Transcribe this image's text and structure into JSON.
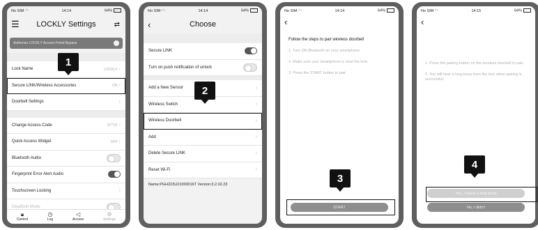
{
  "status": {
    "carrier": "No SIM",
    "wifi_icon": "wifi-icon",
    "battery_icon": "battery-icon",
    "p1_time": "14:14",
    "p1_battery": "64%",
    "p2_time": "14:14",
    "p2_battery": "64%",
    "p3_time": "14:14",
    "p3_battery": "64%",
    "p4_time": "14:15",
    "p4_battery": "64%"
  },
  "screen1": {
    "title": "LOCKLY Settings",
    "menu_icon": "menu-icon",
    "sync_icon": "sync-icon",
    "banner_label": "Authorize LOCKLY Access Portal Bypass",
    "rows": [
      {
        "label": "Lock Name",
        "value": "LOCKLY"
      },
      {
        "label": "Secure LINK/Wireless Accessories",
        "value": "ON"
      },
      {
        "label": "Doorbell Settings",
        "value": ""
      },
      {
        "label": "Change Access Code",
        "value": "22**22"
      },
      {
        "label": "Quick Access Widget",
        "value": "OFF"
      },
      {
        "label": "Bluetooth Audio",
        "value": ""
      },
      {
        "label": "Fingerprint Error Alert Audio",
        "value": ""
      },
      {
        "label": "Touchscreen Locking",
        "value": ""
      },
      {
        "label": "Deadbolt Mode",
        "value": ""
      }
    ],
    "tabs": [
      "Control",
      "Log",
      "Access",
      "Settings"
    ]
  },
  "screen2": {
    "title": "Choose",
    "rows": [
      {
        "label": "Secure LINK"
      },
      {
        "label": "Turn on push notification of unlock"
      },
      {
        "label": "Add a New Sensor"
      },
      {
        "label": "Wireless Switch"
      },
      {
        "label": "Wireless Doorbell"
      },
      {
        "label": "Add"
      },
      {
        "label": "Delete Secure LINK"
      },
      {
        "label": "Reset Wi-Fi"
      }
    ],
    "info": "Name:PGH223U21000016T  Version:3.2.02.23"
  },
  "screen3": {
    "heading": "Follow the steps to pair wireless doorbell",
    "steps": [
      "1. Turn ON Bluetooth on your smartphone.",
      "2. Make sure your smartphone is near the lock.",
      "3. Press the START button to pair."
    ],
    "start_label": "START"
  },
  "screen4": {
    "steps": [
      "1. Press the pairing button on the wireless doorbell to pair.",
      "2. You will hear a long beep from the lock when pairing is successful."
    ],
    "yes_label": "Yes, I heard a long beep",
    "no_label": "No, I didn't"
  },
  "callouts": [
    "1",
    "2",
    "3",
    "4"
  ]
}
